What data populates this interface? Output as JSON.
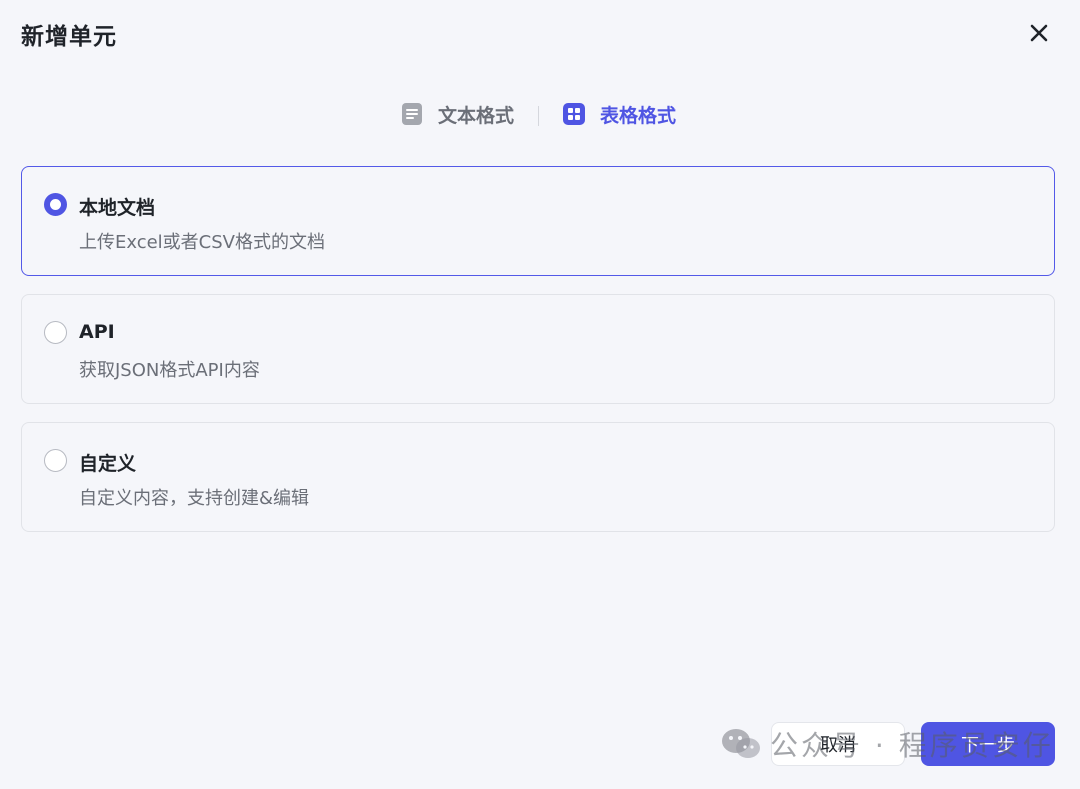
{
  "dialog": {
    "title": "新增单元"
  },
  "tabs": [
    {
      "label": "文本格式",
      "icon": "document-icon",
      "active": false
    },
    {
      "label": "表格格式",
      "icon": "table-icon",
      "active": true
    }
  ],
  "options": [
    {
      "title": "本地文档",
      "description": "上传Excel或者CSV格式的文档",
      "selected": true
    },
    {
      "title": "API",
      "description": "获取JSON格式API内容",
      "selected": false
    },
    {
      "title": "自定义",
      "description": "自定义内容，支持创建&编辑",
      "selected": false
    }
  ],
  "footer": {
    "cancel_label": "取消",
    "next_label": "下一步"
  },
  "watermark": {
    "text": "公众号 · 程序员安仔"
  },
  "colors": {
    "accent": "#4f55e3",
    "background": "#f5f6fa",
    "border": "#e1e3e8"
  }
}
